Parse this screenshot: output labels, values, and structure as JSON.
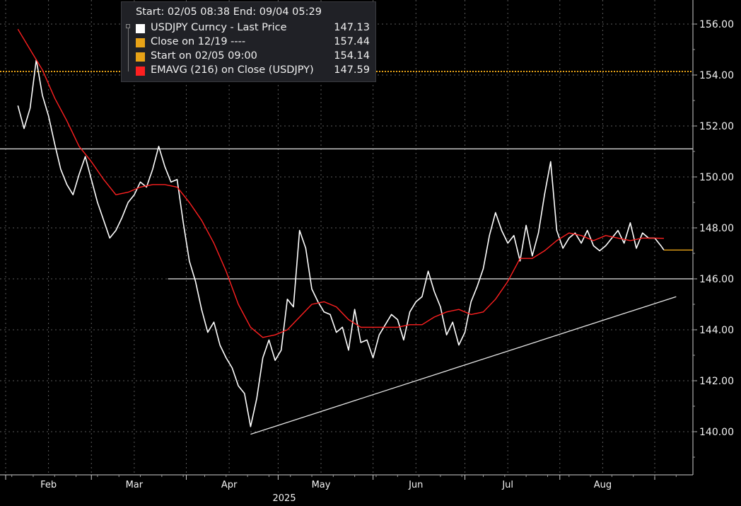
{
  "legend": {
    "header": "Start: 02/05 08:38 End: 09/04 05:29",
    "items": [
      {
        "label": "USDJPY Curncy - Last Price",
        "value": "147.13",
        "color": "#ffffff"
      },
      {
        "label": "Close on 12/19 ----",
        "value": "157.44",
        "color": "#e8a317"
      },
      {
        "label": "Start on 02/05 09:00",
        "value": "154.14",
        "color": "#e8a317"
      },
      {
        "label": "EMAVG (216)  on Close (USDJPY)",
        "value": "147.59",
        "color": "#ff2020"
      }
    ]
  },
  "chart_data": {
    "type": "line",
    "ylim": [
      138.2,
      157.3
    ],
    "yticks": [
      "140.00",
      "142.00",
      "144.00",
      "146.00",
      "148.00",
      "150.00",
      "152.00",
      "154.00",
      "156.00"
    ],
    "xticks": [
      "Feb",
      "Mar",
      "Apr",
      "May",
      "Jun",
      "Jul",
      "Aug"
    ],
    "year_label": "2025",
    "grid": true,
    "last_value": 147.13,
    "reference_lines": [
      {
        "value": 154.14,
        "style": "dotted",
        "color": "#e8a317"
      },
      {
        "value": 151.1,
        "style": "solid",
        "color": "#e6e6e6"
      },
      {
        "value": 146.0,
        "style": "solid",
        "color": "#e6e6e6"
      }
    ],
    "trendline": {
      "from": [
        "2025-04-22",
        139.9
      ],
      "to": [
        "2025-09-08",
        145.3
      ]
    },
    "series": [
      {
        "name": "USDJPY Curncy - Last Price",
        "color": "#ffffff",
        "x": [
          "2025-02-05",
          "2025-02-07",
          "2025-02-09",
          "2025-02-11",
          "2025-02-13",
          "2025-02-15",
          "2025-02-17",
          "2025-02-19",
          "2025-02-21",
          "2025-02-23",
          "2025-02-25",
          "2025-02-27",
          "2025-03-01",
          "2025-03-03",
          "2025-03-05",
          "2025-03-07",
          "2025-03-09",
          "2025-03-11",
          "2025-03-13",
          "2025-03-15",
          "2025-03-17",
          "2025-03-19",
          "2025-03-21",
          "2025-03-23",
          "2025-03-25",
          "2025-03-27",
          "2025-03-29",
          "2025-03-31",
          "2025-04-02",
          "2025-04-04",
          "2025-04-06",
          "2025-04-08",
          "2025-04-10",
          "2025-04-12",
          "2025-04-14",
          "2025-04-16",
          "2025-04-18",
          "2025-04-20",
          "2025-04-22",
          "2025-04-24",
          "2025-04-26",
          "2025-04-28",
          "2025-04-30",
          "2025-05-02",
          "2025-05-04",
          "2025-05-06",
          "2025-05-08",
          "2025-05-10",
          "2025-05-12",
          "2025-05-14",
          "2025-05-16",
          "2025-05-18",
          "2025-05-20",
          "2025-05-22",
          "2025-05-24",
          "2025-05-26",
          "2025-05-28",
          "2025-05-30",
          "2025-06-01",
          "2025-06-03",
          "2025-06-05",
          "2025-06-07",
          "2025-06-09",
          "2025-06-11",
          "2025-06-13",
          "2025-06-15",
          "2025-06-17",
          "2025-06-19",
          "2025-06-21",
          "2025-06-23",
          "2025-06-25",
          "2025-06-27",
          "2025-06-29",
          "2025-07-01",
          "2025-07-03",
          "2025-07-05",
          "2025-07-07",
          "2025-07-09",
          "2025-07-11",
          "2025-07-13",
          "2025-07-15",
          "2025-07-17",
          "2025-07-19",
          "2025-07-21",
          "2025-07-23",
          "2025-07-25",
          "2025-07-27",
          "2025-07-29",
          "2025-07-31",
          "2025-08-02",
          "2025-08-04",
          "2025-08-06",
          "2025-08-08",
          "2025-08-10",
          "2025-08-12",
          "2025-08-14",
          "2025-08-16",
          "2025-08-18",
          "2025-08-20",
          "2025-08-22",
          "2025-08-24",
          "2025-08-26",
          "2025-08-28",
          "2025-08-30",
          "2025-09-01",
          "2025-09-03",
          "2025-09-04"
        ],
        "values": [
          152.8,
          151.9,
          152.7,
          154.6,
          153.2,
          152.4,
          151.3,
          150.3,
          149.7,
          149.3,
          150.1,
          150.8,
          149.9,
          149.0,
          148.3,
          147.6,
          147.9,
          148.4,
          149.0,
          149.3,
          149.8,
          149.6,
          150.3,
          151.2,
          150.4,
          149.8,
          149.9,
          148.2,
          146.7,
          145.9,
          144.8,
          143.9,
          144.3,
          143.4,
          142.9,
          142.5,
          141.8,
          141.5,
          140.2,
          141.3,
          142.9,
          143.6,
          142.8,
          143.2,
          145.2,
          144.9,
          147.9,
          147.2,
          145.6,
          145.1,
          144.7,
          144.6,
          143.9,
          144.1,
          143.2,
          144.8,
          143.5,
          143.6,
          142.9,
          143.8,
          144.2,
          144.6,
          144.4,
          143.6,
          144.7,
          145.1,
          145.3,
          146.3,
          145.5,
          144.9,
          143.8,
          144.3,
          143.4,
          143.9,
          145.1,
          145.7,
          146.4,
          147.7,
          148.6,
          147.9,
          147.4,
          147.7,
          146.7,
          148.1,
          146.9,
          147.8,
          149.3,
          150.6,
          147.9,
          147.2,
          147.6,
          147.8,
          147.4,
          147.9,
          147.3,
          147.1,
          147.3,
          147.6,
          147.9,
          147.4,
          148.2,
          147.2,
          147.8,
          147.6,
          147.6,
          147.3,
          147.13
        ]
      },
      {
        "name": "EMAVG (216)  on Close (USDJPY)",
        "color": "#ff2020",
        "x": [
          "2025-02-05",
          "2025-02-09",
          "2025-02-13",
          "2025-02-17",
          "2025-02-21",
          "2025-02-25",
          "2025-03-01",
          "2025-03-05",
          "2025-03-09",
          "2025-03-13",
          "2025-03-17",
          "2025-03-21",
          "2025-03-25",
          "2025-03-29",
          "2025-04-02",
          "2025-04-06",
          "2025-04-10",
          "2025-04-14",
          "2025-04-18",
          "2025-04-22",
          "2025-04-26",
          "2025-04-30",
          "2025-05-04",
          "2025-05-08",
          "2025-05-12",
          "2025-05-16",
          "2025-05-20",
          "2025-05-24",
          "2025-05-28",
          "2025-06-01",
          "2025-06-05",
          "2025-06-09",
          "2025-06-13",
          "2025-06-17",
          "2025-06-21",
          "2025-06-25",
          "2025-06-29",
          "2025-07-03",
          "2025-07-07",
          "2025-07-11",
          "2025-07-15",
          "2025-07-19",
          "2025-07-23",
          "2025-07-27",
          "2025-07-31",
          "2025-08-04",
          "2025-08-08",
          "2025-08-12",
          "2025-08-16",
          "2025-08-20",
          "2025-08-24",
          "2025-08-28",
          "2025-09-01",
          "2025-09-04"
        ],
        "values": [
          155.8,
          155.0,
          154.2,
          153.1,
          152.2,
          151.2,
          150.6,
          149.9,
          149.3,
          149.4,
          149.6,
          149.7,
          149.7,
          149.6,
          149.0,
          148.3,
          147.4,
          146.3,
          145.0,
          144.1,
          143.7,
          143.8,
          144.0,
          144.5,
          145.0,
          145.1,
          144.9,
          144.4,
          144.1,
          144.1,
          144.1,
          144.1,
          144.2,
          144.2,
          144.5,
          144.7,
          144.8,
          144.6,
          144.7,
          145.2,
          145.9,
          146.8,
          146.8,
          147.1,
          147.5,
          147.8,
          147.7,
          147.5,
          147.7,
          147.6,
          147.5,
          147.6,
          147.6,
          147.59
        ]
      }
    ]
  }
}
